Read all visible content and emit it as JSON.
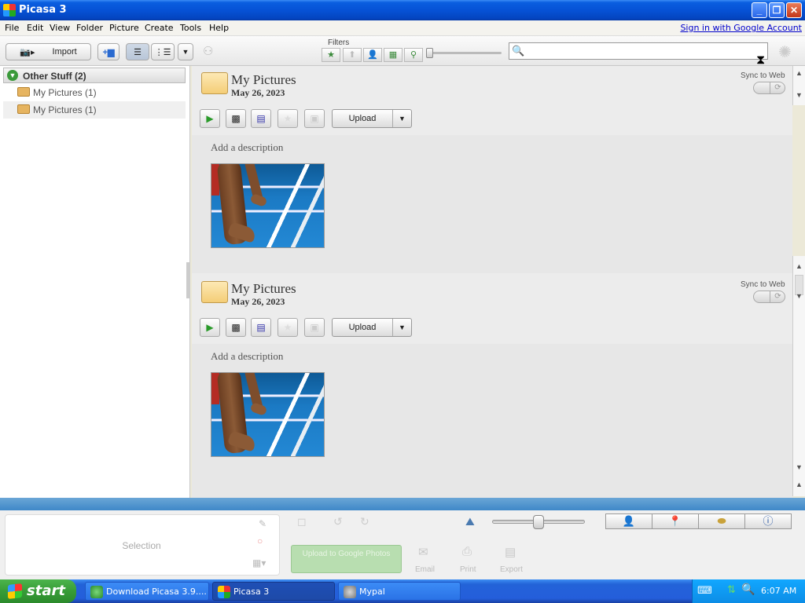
{
  "window": {
    "title": "Picasa 3",
    "minimize": "_",
    "maximize": "❐",
    "close": "✕"
  },
  "menu": [
    "File",
    "Edit",
    "View",
    "Folder",
    "Picture",
    "Create",
    "Tools",
    "Help"
  ],
  "signin_link": "Sign in with Google Account",
  "toolbar": {
    "import_label": "Import",
    "filters_label": "Filters",
    "search_placeholder": ""
  },
  "left_panel": {
    "header": "Other Stuff (2)",
    "items": [
      {
        "label": "My Pictures (1)"
      },
      {
        "label": "My Pictures (1)"
      }
    ]
  },
  "folders": [
    {
      "name": "My Pictures",
      "date": "May 26, 2023",
      "sync_label": "Sync to Web",
      "upload_label": "Upload",
      "description_placeholder": "Add a description"
    },
    {
      "name": "My Pictures",
      "date": "May 26, 2023",
      "sync_label": "Sync to Web",
      "upload_label": "Upload",
      "description_placeholder": "Add a description"
    }
  ],
  "tray": {
    "selection_label": "Selection",
    "upload_google": "Upload to Google Photos",
    "email": "Email",
    "print": "Print",
    "export": "Export"
  },
  "taskbar": {
    "start": "start",
    "tasks": [
      {
        "label": "Download Picasa 3.9...."
      },
      {
        "label": "Picasa 3"
      },
      {
        "label": "Mypal"
      }
    ],
    "clock": "6:07 AM"
  },
  "colors": {
    "accent_green": "#3b9a3b",
    "title_blue": "#0652d6",
    "taskbar_blue": "#245edb"
  }
}
